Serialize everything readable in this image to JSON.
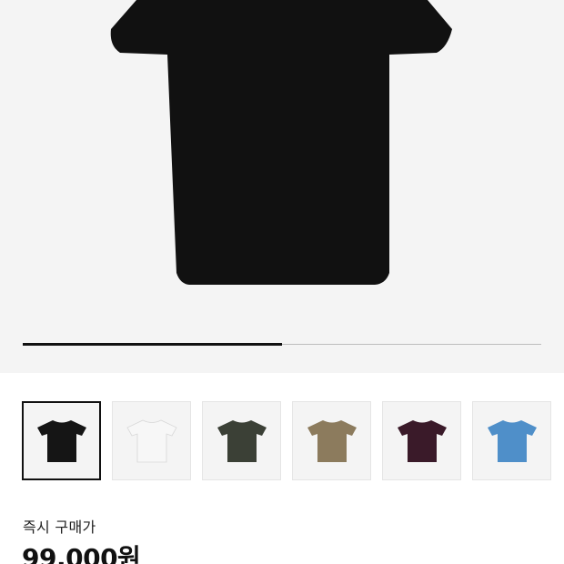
{
  "product": {
    "main_image": "black-tshirt-back-view",
    "main_color": "#111111",
    "gallery_progress": 0.5
  },
  "thumbnails": [
    {
      "name": "black",
      "color": "#151515",
      "selected": true
    },
    {
      "name": "white",
      "color": "#f7f7f7",
      "selected": false
    },
    {
      "name": "dark-green",
      "color": "#3b4036",
      "selected": false
    },
    {
      "name": "olive-tan",
      "color": "#8c7b5d",
      "selected": false
    },
    {
      "name": "burgundy",
      "color": "#3a1a29",
      "selected": false
    },
    {
      "name": "blue",
      "color": "#4f8fc9",
      "selected": false
    }
  ],
  "pricing": {
    "label": "즉시 구매가",
    "value": "99,000원"
  }
}
